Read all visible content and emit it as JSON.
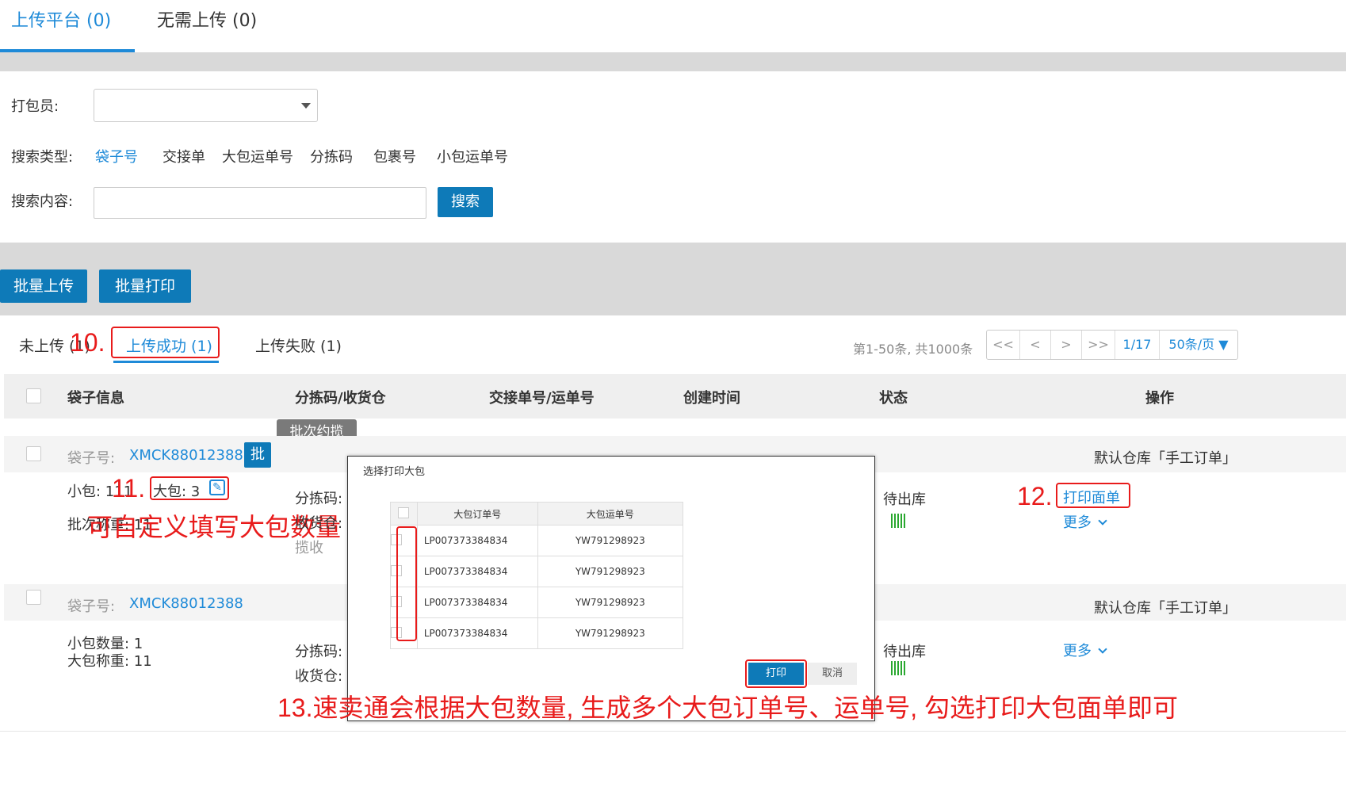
{
  "top_tabs": {
    "upload_platform": "上传平台 (0)",
    "no_upload": "无需上传 (0)"
  },
  "filters": {
    "packer_label": "打包员:",
    "search_type_label": "搜索类型:",
    "search_types": [
      "袋子号",
      "交接单",
      "大包运单号",
      "分拣码",
      "包裹号",
      "小包运单号"
    ],
    "search_content_label": "搜索内容:",
    "search_button": "搜索"
  },
  "bulk": {
    "upload": "批量上传",
    "print": "批量打印"
  },
  "status_tabs": {
    "not_uploaded": "未上传 (1)",
    "success": "上传成功 (1)",
    "failed": "上传失败 (1)"
  },
  "pagination": {
    "info": "第1-50条, 共1000条",
    "first": "<<",
    "prev": "<",
    "next": ">",
    "last": ">>",
    "page": "1/17",
    "per_page": "50条/页 ▼"
  },
  "table_header": {
    "bag_info": "袋子信息",
    "sort_code": "分拣码/收货仓",
    "handover": "交接单号/运单号",
    "created": "创建时间",
    "status": "状态",
    "ops": "操作"
  },
  "tooltip": "批次约揽",
  "rows": [
    {
      "bag_label": "袋子号:",
      "bag_no": "XMCK88012388",
      "badge": "批",
      "warehouse": "默认仓库「手工订单」",
      "small_pkg": "小包: 111",
      "big_pkg": "大包: 3",
      "batch_weight": "批次称重: 11",
      "sort_code_label": "分拣码:",
      "receive_label": "收货仓:",
      "pickup_label": "揽收",
      "status": "待出库",
      "print_label": "打印面单",
      "more": "更多"
    },
    {
      "bag_label": "袋子号:",
      "bag_no": "XMCK88012388",
      "warehouse": "默认仓库「手工订单」",
      "small_count": "小包数量: 1",
      "big_weight": "大包称重: 11",
      "sort_code_label": "分拣码:",
      "receive_label": "收货仓:",
      "status": "待出库",
      "more": "更多"
    }
  ],
  "modal": {
    "title": "选择打印大包",
    "col_order": "大包订单号",
    "col_waybill": "大包运单号",
    "items": [
      {
        "order": "LP007373384834",
        "waybill": "YW791298923"
      },
      {
        "order": "LP007373384834",
        "waybill": "YW791298923"
      },
      {
        "order": "LP007373384834",
        "waybill": "YW791298923"
      },
      {
        "order": "LP007373384834",
        "waybill": "YW791298923"
      }
    ],
    "print": "打印",
    "cancel": "取消"
  },
  "annotations": {
    "n10": "10.",
    "n11": "11.",
    "n12": "12.",
    "custom_note": "可自定义填写大包数量",
    "note13": "13.速卖通会根据大包数量, 生成多个大包订单号、运单号, 勾选打印大包面单即可"
  },
  "colors": {
    "accent": "#1e8ad8",
    "primary_button": "#0e7ab8",
    "annotation": "#e81b1b"
  }
}
